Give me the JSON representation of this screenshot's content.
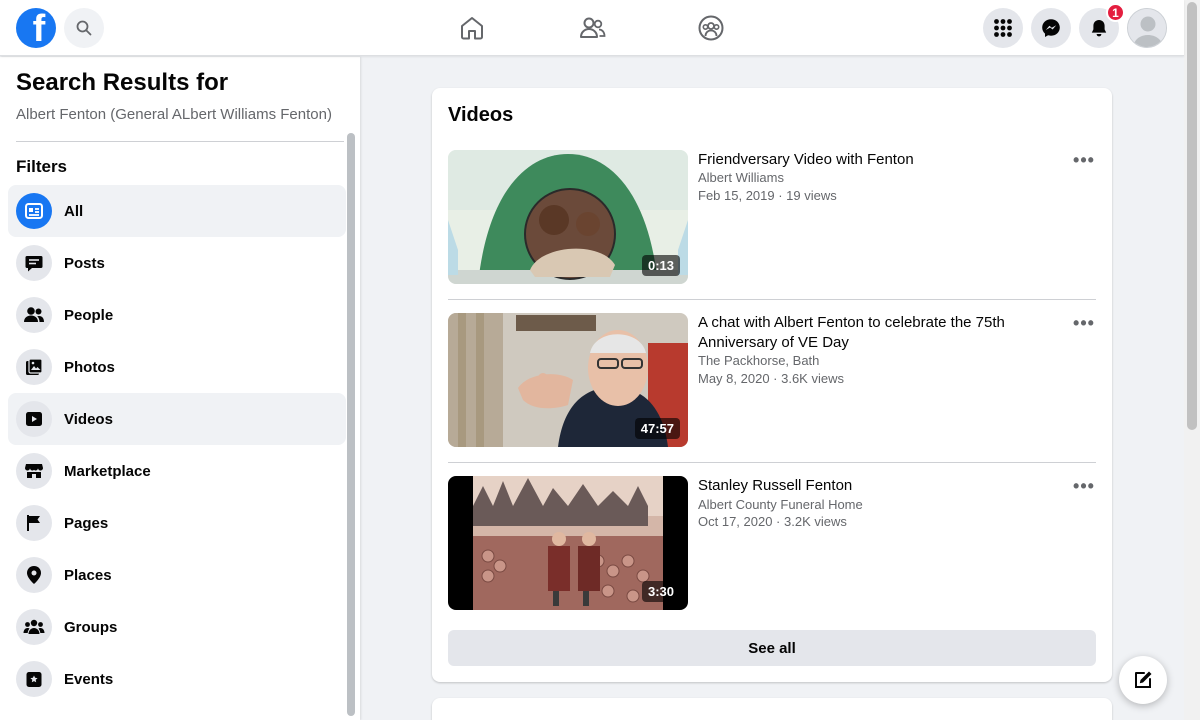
{
  "topbar": {
    "logo_letter": "f",
    "notification_badge": "1",
    "icons": [
      "facebook-logo",
      "search-icon",
      "home-icon",
      "friends-icon",
      "groups-icon",
      "menu-grid-icon",
      "messenger-icon",
      "bell-icon",
      "avatar"
    ]
  },
  "sidebar": {
    "title": "Search Results for",
    "query": "Albert Fenton (General ALbert Williams Fenton)",
    "filters_heading": "Filters",
    "items": [
      {
        "label": "All",
        "icon": "all-icon",
        "active": true
      },
      {
        "label": "Posts",
        "icon": "posts-icon"
      },
      {
        "label": "People",
        "icon": "people-icon"
      },
      {
        "label": "Photos",
        "icon": "photos-icon"
      },
      {
        "label": "Videos",
        "icon": "videos-icon"
      },
      {
        "label": "Marketplace",
        "icon": "marketplace-icon"
      },
      {
        "label": "Pages",
        "icon": "flag-icon"
      },
      {
        "label": "Places",
        "icon": "location-pin-icon"
      },
      {
        "label": "Groups",
        "icon": "groups-icon"
      },
      {
        "label": "Events",
        "icon": "calendar-star-icon"
      }
    ]
  },
  "videos": {
    "heading": "Videos",
    "items": [
      {
        "title": "Friendversary Video with Fenton",
        "author": "Albert Williams",
        "meta": "Feb 15, 2019 · 19 views",
        "duration": "0:13"
      },
      {
        "title": "A chat with Albert Fenton to celebrate the 75th Anniversary of VE Day",
        "author": "The Packhorse, Bath",
        "meta": "May 8, 2020 · 3.6K views",
        "duration": "47:57"
      },
      {
        "title": "Stanley Russell Fenton",
        "author": "Albert County Funeral Home",
        "meta": "Oct 17, 2020 · 3.2K views",
        "duration": "3:30"
      }
    ],
    "see_all": "See all",
    "more_label": "•••"
  },
  "colors": {
    "brand": "#1877f2",
    "background": "#f0f2f5",
    "badge": "#e41e3f",
    "secondary_text": "#65676b"
  }
}
